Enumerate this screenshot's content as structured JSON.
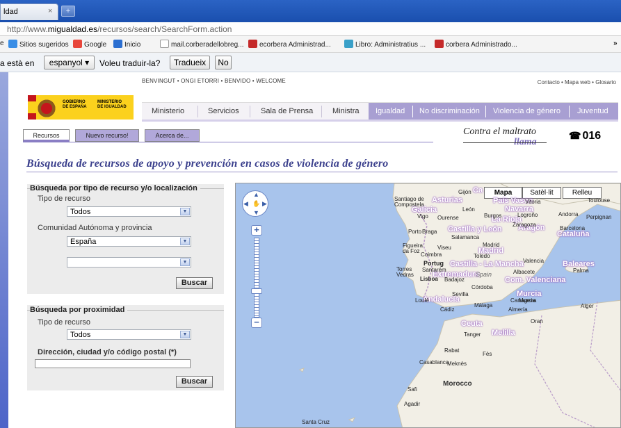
{
  "browser": {
    "tab_title": "ldad",
    "tab_close": "×",
    "new_tab": "+",
    "url_prefix": "http://www.",
    "url_domain": "migualdad.es",
    "url_path": "/recursos/search/SearchForm.action"
  },
  "bookmarks": [
    {
      "label": "Sitios sugeridos",
      "color": "#3a8ee6"
    },
    {
      "label": "Google",
      "color": "#e8463b"
    },
    {
      "label": "Inicio",
      "color": "#2c6fd1"
    },
    {
      "label": "mail.corberadellobreg...",
      "color": "#cccccc"
    },
    {
      "label": "ecorbera Administrad...",
      "color": "#c52a2a"
    },
    {
      "label": "Libro: Administratius ...",
      "color": "#3aa0c8"
    },
    {
      "label": "corbera Administrado...",
      "color": "#c52a2a"
    }
  ],
  "bookmarks_overflow": "»",
  "translate_bar": {
    "prefix": "a està en",
    "language": "espanyol ▾",
    "question": "Voleu traduir-la?",
    "translate_button": "Tradueix",
    "no_button": "No"
  },
  "site": {
    "top_nav": "BENVINGUT  • ONGI ETORRI  • BENVIDO  • WELCOME",
    "top_links": "Contacto • Mapa web • Glosario",
    "logo_gobierno": "GOBIERNO\nDE ESPAÑA",
    "logo_ministerio": "MINISTERIO\nDE IGUALDAD",
    "main_nav": [
      "Ministerio",
      "Servicios",
      "Sala de Prensa",
      "Ministra",
      "Igualdad",
      "No discriminación",
      "Violencia de género",
      "Juventud"
    ],
    "sub_tabs": [
      "Recursos",
      "Nuevo recurso!",
      "Acerca de..."
    ],
    "slogan_line1": "Contra el maltrato",
    "slogan_line2": "llama",
    "phone": "016",
    "page_title": "Búsqueda de recursos de apoyo y prevención en casos de violencia de género"
  },
  "search_type": {
    "title": "Búsqueda por tipo de recurso y/o localización",
    "tipo_label": "Tipo de recurso",
    "tipo_value": "Todos",
    "comunidad_label": "Comunidad Autónoma y provincia",
    "comunidad_value": "España",
    "provincia_value": "",
    "button": "Buscar"
  },
  "search_proximity": {
    "title": "Búsqueda por proximidad",
    "tipo_label": "Tipo de recurso",
    "tipo_value": "Todos",
    "address_label": "Dirección, ciudad y/o código postal (*)",
    "address_value": "",
    "button": "Buscar"
  },
  "map": {
    "types": [
      "Mapa",
      "Satèl·lit",
      "Relleu"
    ],
    "selected_type": "Mapa",
    "regions": [
      "Asturias",
      "País Vasco",
      "Navarra",
      "Galicia",
      "La Rioja",
      "Aragón",
      "Castilla y León",
      "Cataluña",
      "Madrid",
      "Castilla - La Mancha",
      "Extremadura",
      "Com. Valenciana",
      "Baleares",
      "Andalucía",
      "Murcia",
      "Ceuta",
      "Melilla",
      "Ca"
    ],
    "cities": [
      "Gijón",
      "Santiago de Compostela",
      "León",
      "Vigo",
      "Ourense",
      "Burgos",
      "Vitoria",
      "Logroño",
      "Andorra",
      "Perpignan",
      "Toulouse",
      "Zaragoza",
      "Barcelona",
      "Porto",
      "Braga",
      "Salamanca",
      "Madrid",
      "Figueira da Foz",
      "Viseu",
      "Coimbra",
      "Toledo",
      "Valencia",
      "Portug",
      "Santarém",
      "Torres Vedras",
      "Lisboa",
      "Badajoz",
      "Spain",
      "Albacete",
      "Palma",
      "Córdoba",
      "Sevilla",
      "Murcia",
      "Loulé",
      "Cádiz",
      "Málaga",
      "Cartagena",
      "Almería",
      "Tanger",
      "Oran",
      "Alger",
      "Rabat",
      "Fès",
      "Casablanca",
      "Meknès",
      "Safi",
      "Agadir",
      "Santa Cruz"
    ],
    "country": "Morocco"
  }
}
